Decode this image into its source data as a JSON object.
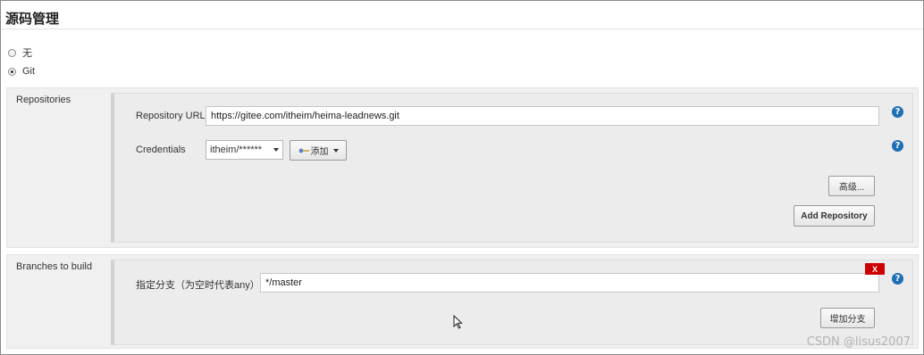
{
  "section": {
    "title": "源码管理"
  },
  "scm_options": [
    {
      "label": "无",
      "checked": false
    },
    {
      "label": "Git",
      "checked": true
    }
  ],
  "repositories": {
    "label": "Repositories",
    "url_label": "Repository URL",
    "url_value": "https://gitee.com/itheim/heima-leadnews.git",
    "credentials_label": "Credentials",
    "credentials_value": "itheim/******",
    "add_label": "添加",
    "advanced_label": "高级...",
    "add_repository_label": "Add Repository"
  },
  "branches": {
    "label": "Branches to build",
    "specifier_label": "指定分支（为空时代表any）",
    "specifier_value": "*/master",
    "delete_label": "X",
    "add_branch_label": "增加分支"
  },
  "help_glyph": "?",
  "watermark": "CSDN @lisus2007",
  "icons": {
    "help": "help-icon",
    "key": "key-icon",
    "dropdown": "caret-down-icon",
    "cursor": "mouse-cursor-icon"
  },
  "colors": {
    "help": "#1f6fb4",
    "delete": "#cc0000",
    "panel": "#f0f0f0"
  }
}
